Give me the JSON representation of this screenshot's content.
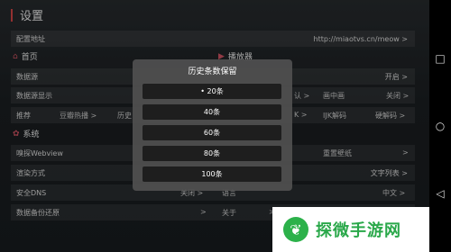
{
  "title": "设置",
  "config": {
    "label": "配置地址",
    "value": "http://miaotvs.cn/meow >"
  },
  "section_home": {
    "icon": "home-icon",
    "label": "首页"
  },
  "section_player": {
    "icon": "play-icon",
    "label": "播放器"
  },
  "source": {
    "label": "数据源",
    "value": "开启 >"
  },
  "source_display": {
    "label": "数据源显示",
    "mid": "认 >",
    "pip_label": "画中画",
    "pip_value": "关闭 >"
  },
  "recommend": {
    "label": "推荐",
    "value": "豆瓣热播 >",
    "history": "历史",
    "decoder_k": "K >",
    "ijk": "IJK解码",
    "hw": "硬解码 >"
  },
  "section_system": {
    "icon": "gear-icon",
    "label": "系统"
  },
  "sniff": {
    "label": "嗅探Webview",
    "right_label": "重置壁纸",
    "arrow": ">"
  },
  "render": {
    "label": "渲染方式",
    "value": "文字列表 >"
  },
  "dns": {
    "label": "安全DNS",
    "mid": "关闭 >",
    "lang": "语言",
    "value": "中文 >"
  },
  "backup": {
    "label": "数据备份还原",
    "arrow": ">",
    "about": "关于",
    "arrow2": ">"
  },
  "dialog": {
    "title": "历史条数保留",
    "options": [
      "• 20条",
      "40条",
      "60条",
      "80条",
      "100条"
    ]
  },
  "watermark": {
    "text": "探微手游网"
  },
  "nav": {
    "back": "◁",
    "home": "○",
    "recent": "□"
  }
}
